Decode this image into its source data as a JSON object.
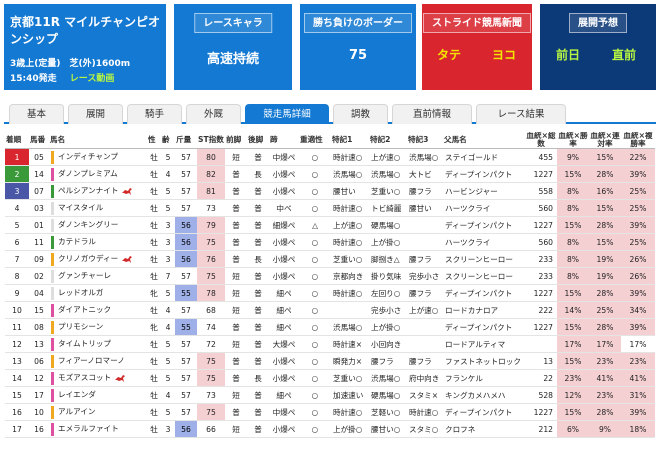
{
  "race": {
    "title": "京都11R マイルチャンピオンシップ",
    "conditions": "3歳上(定量)　芝(外)1600m",
    "time": "15:40発走",
    "video_label": "レース動画"
  },
  "cards": [
    {
      "button": "レースキャラ",
      "value": "高速持続"
    },
    {
      "button": "勝ち負けのボーダー",
      "value": "75"
    },
    {
      "button": "ストライド競馬新聞",
      "left": "タテ",
      "right": "ヨコ"
    },
    {
      "button": "展開予想",
      "left": "前日",
      "right": "直前"
    }
  ],
  "tabs": [
    "基本",
    "展開",
    "騎手",
    "外厩",
    "競走馬詳細",
    "調教",
    "直前情報",
    "レース結果"
  ],
  "active_tab": 4,
  "columns": [
    "着順",
    "馬番",
    "馬名",
    "性",
    "齢",
    "斤量",
    "ST指数",
    "前脚",
    "後脚",
    "蹄",
    "重適性",
    "特記1",
    "特記2",
    "特記3",
    "父馬名",
    "血統×総数",
    "血統×勝率",
    "血統×連対率",
    "血統×複勝率"
  ],
  "rows": [
    {
      "rank": "1",
      "num": "05",
      "frame": "#f0a820",
      "name": "インディチャンプ",
      "sex": "牡",
      "age": "5",
      "kin": "57",
      "st": "80",
      "fore": "短",
      "hind": "普",
      "hoof": "中爆ペ",
      "heavy": "○",
      "n1": "時計速○",
      "n2": "上が速○",
      "n3": "渋馬場○",
      "sire": "ステイゴールド",
      "total": "455",
      "win": "9%",
      "ren": "15%",
      "fuku": "22%",
      "icon": false
    },
    {
      "rank": "2",
      "num": "14",
      "frame": "#e050a0",
      "name": "ダノンプレミアム",
      "sex": "牡",
      "age": "4",
      "kin": "57",
      "st": "82",
      "fore": "普",
      "hind": "長",
      "hoof": "小爆ペ",
      "heavy": "○",
      "n1": "渋馬場○",
      "n2": "渋馬場○",
      "n3": "大トビ",
      "sire": "ディープインパクト",
      "total": "1227",
      "win": "15%",
      "ren": "28%",
      "fuku": "39%",
      "icon": false
    },
    {
      "rank": "3",
      "num": "07",
      "frame": "#3a9a3a",
      "name": "ペルシアンナイト",
      "sex": "牡",
      "age": "5",
      "kin": "57",
      "st": "81",
      "fore": "普",
      "hind": "普",
      "hoof": "小爆ペ",
      "heavy": "○",
      "n1": "腰甘い",
      "n2": "芝重い○",
      "n3": "腰フラ",
      "sire": "ハービンジャー",
      "total": "558",
      "win": "8%",
      "ren": "16%",
      "fuku": "25%",
      "icon": true
    },
    {
      "rank": "4",
      "num": "03",
      "frame": "#dddddd",
      "name": "マイスタイル",
      "sex": "牡",
      "age": "5",
      "kin": "57",
      "st": "73",
      "fore": "普",
      "hind": "普",
      "hoof": "中ベ",
      "heavy": "○",
      "n1": "時計速○",
      "n2": "トビ綺麗",
      "n3": "腰甘い",
      "sire": "ハーツクライ",
      "total": "560",
      "win": "8%",
      "ren": "15%",
      "fuku": "25%",
      "icon": false
    },
    {
      "rank": "5",
      "num": "01",
      "frame": "#dddddd",
      "name": "ダノンキングリー",
      "sex": "牡",
      "age": "3",
      "kin": "56",
      "st": "79",
      "fore": "普",
      "hind": "普",
      "hoof": "細爆ペ",
      "heavy": "△",
      "n1": "上が速○",
      "n2": "硬馬場○",
      "n3": "",
      "sire": "ディープインパクト",
      "total": "1227",
      "win": "15%",
      "ren": "28%",
      "fuku": "39%",
      "icon": false
    },
    {
      "rank": "6",
      "num": "11",
      "frame": "#3a9a3a",
      "name": "カテドラル",
      "sex": "牡",
      "age": "3",
      "kin": "56",
      "st": "75",
      "fore": "普",
      "hind": "普",
      "hoof": "小爆ペ",
      "heavy": "○",
      "n1": "時計速○",
      "n2": "上が掛○",
      "n3": "",
      "sire": "ハーツクライ",
      "total": "560",
      "win": "8%",
      "ren": "15%",
      "fuku": "25%",
      "icon": false
    },
    {
      "rank": "7",
      "num": "09",
      "frame": "#f0a820",
      "name": "クリノガウディー",
      "sex": "牡",
      "age": "3",
      "kin": "56",
      "st": "76",
      "fore": "普",
      "hind": "長",
      "hoof": "小爆ペ",
      "heavy": "○",
      "n1": "芝重い○",
      "n2": "脚捌き△",
      "n3": "腰フラ",
      "sire": "スクリーンヒーロー",
      "total": "233",
      "win": "8%",
      "ren": "19%",
      "fuku": "26%",
      "icon": true
    },
    {
      "rank": "8",
      "num": "02",
      "frame": "#dddddd",
      "name": "グァンチャーレ",
      "sex": "牡",
      "age": "7",
      "kin": "57",
      "st": "75",
      "fore": "短",
      "hind": "普",
      "hoof": "小爆ペ",
      "heavy": "○",
      "n1": "京都向き",
      "n2": "掛り気味",
      "n3": "完歩小さ",
      "sire": "スクリーンヒーロー",
      "total": "233",
      "win": "8%",
      "ren": "19%",
      "fuku": "26%",
      "icon": false
    },
    {
      "rank": "9",
      "num": "04",
      "frame": "#dddddd",
      "name": "レッドオルガ",
      "sex": "牝",
      "age": "5",
      "kin": "55",
      "st": "78",
      "fore": "短",
      "hind": "普",
      "hoof": "細ペ",
      "heavy": "○",
      "n1": "時計速○",
      "n2": "左回り○",
      "n3": "腰フラ",
      "sire": "ディープインパクト",
      "total": "1227",
      "win": "15%",
      "ren": "28%",
      "fuku": "39%",
      "icon": false
    },
    {
      "rank": "10",
      "num": "15",
      "frame": "#e050a0",
      "name": "ダイアトニック",
      "sex": "牡",
      "age": "4",
      "kin": "57",
      "st": "68",
      "fore": "短",
      "hind": "普",
      "hoof": "細ペ",
      "heavy": "○",
      "n1": "",
      "n2": "完歩小さ",
      "n3": "上が速○",
      "sire": "ロードカナロア",
      "total": "222",
      "win": "14%",
      "ren": "25%",
      "fuku": "34%",
      "icon": false
    },
    {
      "rank": "11",
      "num": "08",
      "frame": "#f0a820",
      "name": "プリモシーン",
      "sex": "牝",
      "age": "4",
      "kin": "55",
      "st": "74",
      "fore": "普",
      "hind": "普",
      "hoof": "細ペ",
      "heavy": "○",
      "n1": "渋馬場○",
      "n2": "上が掛○",
      "n3": "",
      "sire": "ディープインパクト",
      "total": "1227",
      "win": "15%",
      "ren": "28%",
      "fuku": "39%",
      "icon": false
    },
    {
      "rank": "12",
      "num": "13",
      "frame": "#e050a0",
      "name": "タイムトリップ",
      "sex": "牡",
      "age": "5",
      "kin": "57",
      "st": "72",
      "fore": "短",
      "hind": "普",
      "hoof": "大爆ペ",
      "heavy": "○",
      "n1": "時計速×",
      "n2": "小回向き",
      "n3": "",
      "sire": "ロードアルティマ",
      "total": "",
      "win": "17%",
      "ren": "17%",
      "fuku": "17%",
      "icon": false
    },
    {
      "rank": "13",
      "num": "06",
      "frame": "#f0a820",
      "name": "フィアーノロマーノ",
      "sex": "牡",
      "age": "5",
      "kin": "57",
      "st": "75",
      "fore": "普",
      "hind": "普",
      "hoof": "小爆ペ",
      "heavy": "○",
      "n1": "瞬発力×",
      "n2": "腰フラ",
      "n3": "腰フラ",
      "sire": "ファストネットロック",
      "total": "13",
      "win": "15%",
      "ren": "23%",
      "fuku": "23%",
      "icon": false
    },
    {
      "rank": "14",
      "num": "12",
      "frame": "#e050a0",
      "name": "モズアスコット",
      "sex": "牡",
      "age": "5",
      "kin": "57",
      "st": "75",
      "fore": "普",
      "hind": "長",
      "hoof": "小爆ペ",
      "heavy": "○",
      "n1": "芝重い○",
      "n2": "渋馬場○",
      "n3": "府中向き",
      "sire": "フランケル",
      "total": "22",
      "win": "23%",
      "ren": "41%",
      "fuku": "41%",
      "icon": true
    },
    {
      "rank": "15",
      "num": "17",
      "frame": "#e050a0",
      "name": "レイエンダ",
      "sex": "牡",
      "age": "4",
      "kin": "57",
      "st": "73",
      "fore": "短",
      "hind": "普",
      "hoof": "細ペ",
      "heavy": "○",
      "n1": "加速速い",
      "n2": "硬馬場○",
      "n3": "スタミ×",
      "sire": "キングカメハメハ",
      "total": "528",
      "win": "12%",
      "ren": "23%",
      "fuku": "31%",
      "icon": false
    },
    {
      "rank": "16",
      "num": "10",
      "frame": "#f0a820",
      "name": "アルアイン",
      "sex": "牡",
      "age": "5",
      "kin": "57",
      "st": "75",
      "fore": "普",
      "hind": "普",
      "hoof": "中爆ペ",
      "heavy": "○",
      "n1": "時計速○",
      "n2": "芝軽い○",
      "n3": "時計速○",
      "sire": "ディープインパクト",
      "total": "1227",
      "win": "15%",
      "ren": "28%",
      "fuku": "39%",
      "icon": false
    },
    {
      "rank": "17",
      "num": "16",
      "frame": "#e050a0",
      "name": "エメラルファイト",
      "sex": "牡",
      "age": "3",
      "kin": "56",
      "st": "66",
      "fore": "短",
      "hind": "普",
      "hoof": "小爆ペ",
      "heavy": "○",
      "n1": "上が掛○",
      "n2": "腰甘い○",
      "n3": "スタミ○",
      "sire": "クロフネ",
      "total": "212",
      "win": "6%",
      "ren": "9%",
      "fuku": "18%",
      "icon": false
    }
  ]
}
